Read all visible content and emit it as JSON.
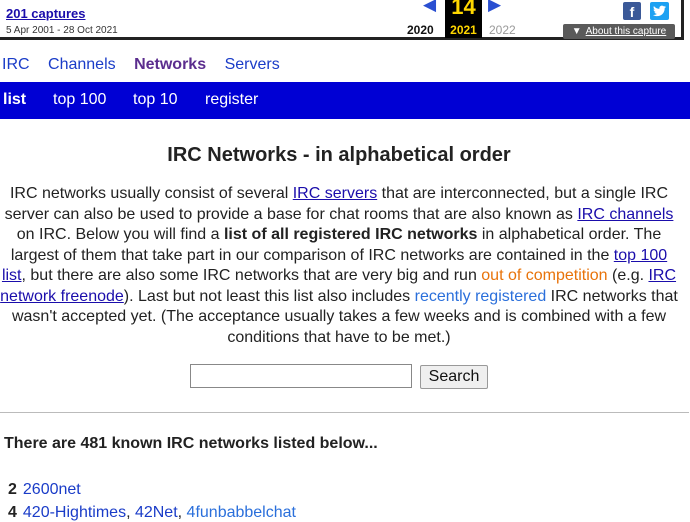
{
  "wayback": {
    "captures": "201 captures",
    "range": "5 Apr 2001 - 28 Oct 2021",
    "prev_year": "2020",
    "current_day": "14",
    "current_year": "2021",
    "next_year": "2022",
    "about": "About this capture",
    "facebook_glyph": "f",
    "left_arrow": "◀",
    "right_arrow": "▶",
    "caret": "▼"
  },
  "top_nav": {
    "irc": "IRC",
    "channels": "Channels",
    "networks": "Networks",
    "servers": "Servers"
  },
  "sub_nav": {
    "list": "list",
    "top100": "top 100",
    "top10": "top 10",
    "register": "register"
  },
  "page": {
    "title": "IRC Networks - in alphabetical order",
    "intro": {
      "t1": "IRC networks usually consist of several ",
      "l1": "IRC servers",
      "t2": " that are interconnected, but a single IRC server can also be used to provide a base for chat rooms that are also known as ",
      "l2": "IRC channels",
      "t3": " on IRC. Below you will find a ",
      "b1": "list of all registered IRC networks",
      "t4": " in alphabetical order. The largest of them that take part in our comparison of IRC networks are contained in the ",
      "l3": "top 100 list",
      "t5": ", but there are also some IRC networks that are very big and run ",
      "l4": "out of competition",
      "t6": " (e.g. ",
      "l5": "IRC network freenode",
      "t7": "). Last but not least this list also includes ",
      "l6": "recently registered",
      "t8": " IRC networks that wasn't accepted yet. (The acceptance usually takes a few weeks and is combined with a few conditions that have to be met.)"
    },
    "search_button": "Search",
    "count_line": "There are 481 known IRC networks listed below...",
    "groups": [
      {
        "number": "2",
        "networks": [
          "2600net"
        ]
      },
      {
        "number": "4",
        "networks": [
          "420-Hightimes",
          "42Net",
          "4funbabbelchat"
        ]
      }
    ],
    "separator": ", "
  },
  "colors": {
    "blue_bar": "#0000d4",
    "link": "#1a3cc8",
    "active_nav": "#5b2d8e",
    "orange": "#e8730a",
    "recent": "#2a6fdb"
  }
}
